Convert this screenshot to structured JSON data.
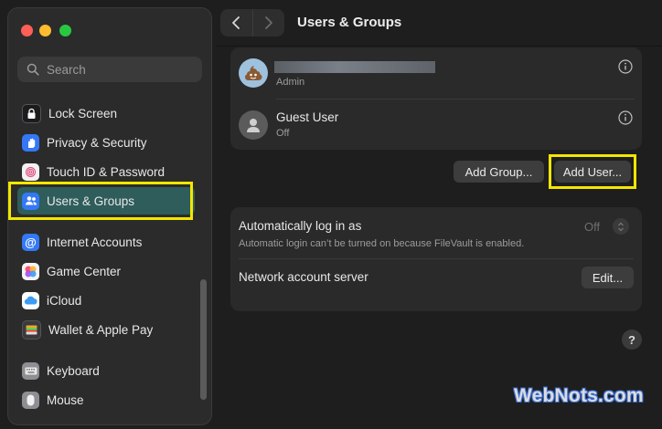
{
  "window": {
    "title": "Users & Groups"
  },
  "search": {
    "placeholder": "Search"
  },
  "sidebar": {
    "items": [
      {
        "label": "Lock Screen",
        "icon": "lock-icon",
        "color": "#1c1c1e"
      },
      {
        "label": "Privacy & Security",
        "icon": "hand-icon",
        "color": "#3478f6"
      },
      {
        "label": "Touch ID & Password",
        "icon": "fingerprint-icon",
        "color": "#f2f2f2"
      },
      {
        "label": "Users & Groups",
        "icon": "users-icon",
        "color": "#3478f6",
        "active": true
      },
      {
        "label": "Internet Accounts",
        "icon": "at-icon",
        "color": "#3478f6"
      },
      {
        "label": "Game Center",
        "icon": "game-center-icon",
        "color": "#e0e0e0"
      },
      {
        "label": "iCloud",
        "icon": "cloud-icon",
        "color": "#ffffff"
      },
      {
        "label": "Wallet & Apple Pay",
        "icon": "wallet-icon",
        "color": "#3a3a3c"
      },
      {
        "label": "Keyboard",
        "icon": "keyboard-icon",
        "color": "#8e8e93"
      },
      {
        "label": "Mouse",
        "icon": "mouse-icon",
        "color": "#8e8e93"
      }
    ]
  },
  "users": [
    {
      "name": "",
      "role": "Admin",
      "avatar": "poop-emoji-avatar"
    },
    {
      "name": "Guest User",
      "role": "Off",
      "avatar": "person-silhouette-avatar"
    }
  ],
  "buttons": {
    "add_group": "Add Group...",
    "add_user": "Add User...",
    "edit": "Edit...",
    "help": "?"
  },
  "settings": {
    "auto_login_label": "Automatically log in as",
    "auto_login_value": "Off",
    "auto_login_note": "Automatic login can’t be turned on because FileVault is enabled.",
    "network_label": "Network account server"
  },
  "watermark": "WebNots.com",
  "colors": {
    "highlight": "#f3e600",
    "active_item": "#2e5d5b",
    "accent": "#3478f6"
  }
}
